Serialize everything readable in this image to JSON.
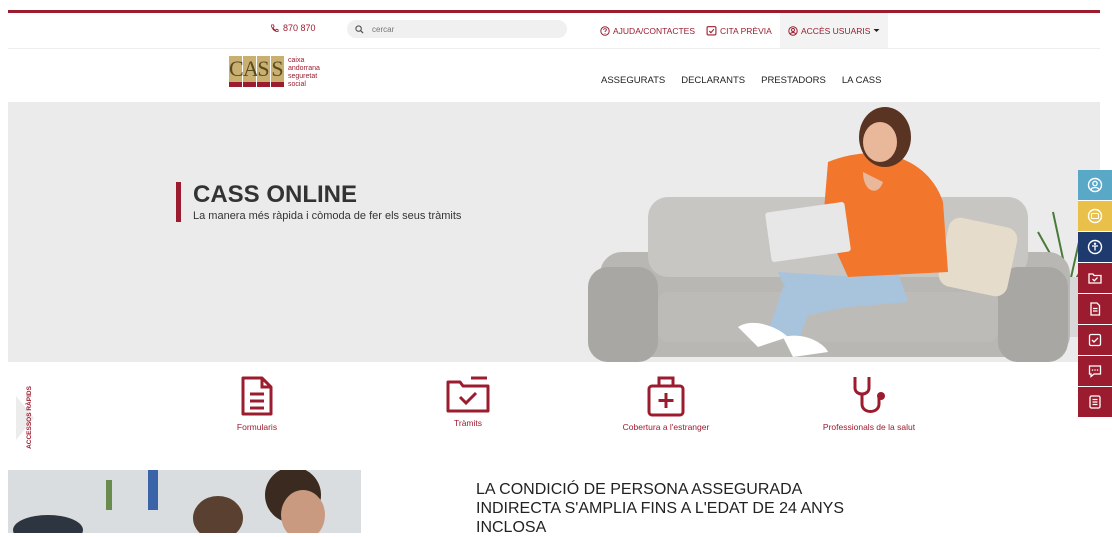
{
  "utility": {
    "phone": "870 870",
    "search_placeholder": "cercar",
    "help": "AJUDA/CONTACTES",
    "appointment": "CITA PRÈVIA",
    "user_access": "ACCÈS USUARIS"
  },
  "logo": {
    "letters": [
      "C",
      "A",
      "S",
      "S"
    ],
    "lines": [
      "caixa",
      "andorrana",
      "seguretat",
      "social"
    ]
  },
  "nav": {
    "items": [
      "ASSEGURATS",
      "DECLARANTS",
      "PRESTADORS",
      "LA CASS"
    ]
  },
  "hero": {
    "title": "CASS ONLINE",
    "subtitle": "La manera més ràpida i còmoda de fer els seus tràmits"
  },
  "quick_access": {
    "label": "ACCESSOS RÀPIDS",
    "items": [
      "Formularis",
      "Tràmits",
      "Cobertura a l'estranger",
      "Professionals de la salut"
    ]
  },
  "news": {
    "title": "LA CONDICIÓ DE PERSONA ASSEGURADA INDIRECTA S'AMPLIA FINS A L'EDAT DE 24 ANYS INCLOSA"
  },
  "colors": {
    "brand": "#9b1c2e",
    "sidebar_blue": "#5aa8c8",
    "sidebar_yellow": "#e8c04a",
    "sidebar_navy": "#1f3a6e"
  }
}
